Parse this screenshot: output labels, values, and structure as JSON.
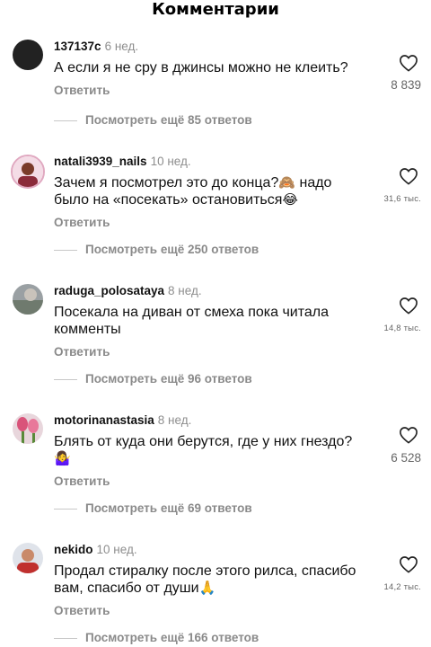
{
  "header": {
    "title": "Комментарии"
  },
  "reply_label": "Ответить",
  "comments": [
    {
      "username": "137137c",
      "age": "6 нед.",
      "text": "А если я не сру в джинсы можно не клеить?",
      "likes": "8 839",
      "view_more": "Посмотреть ещё 85 ответов"
    },
    {
      "username": "natali3939_nails",
      "age": "10 нед.",
      "text_before": "Зачем я посмотрел это до конца?",
      "emoji1": "🙈",
      "text_middle": " надо было на «посекать» остановиться",
      "emoji2": "😂",
      "likes": "31,6 тыс.",
      "view_more": "Посмотреть ещё 250 ответов"
    },
    {
      "username": "raduga_polosataya",
      "age": "8 нед.",
      "text": "Посекала на диван от смеха пока читала комменты",
      "likes": "14,8 тыс.",
      "view_more": "Посмотреть ещё 96 ответов"
    },
    {
      "username": "motorinanastasia",
      "age": "8 нед.",
      "text": "Блять от куда они берутся, где у них гнездо?",
      "emoji": "🤷‍♀️",
      "likes": "6 528",
      "view_more": "Посмотреть ещё 69 ответов"
    },
    {
      "username": "nekido",
      "age": "10 нед.",
      "text": "Продал стиралку после этого рилса, спасибо вам, спасибо от  души",
      "emoji": "🙏",
      "likes": "14,2 тыс.",
      "view_more": "Посмотреть ещё 166 ответов"
    }
  ]
}
